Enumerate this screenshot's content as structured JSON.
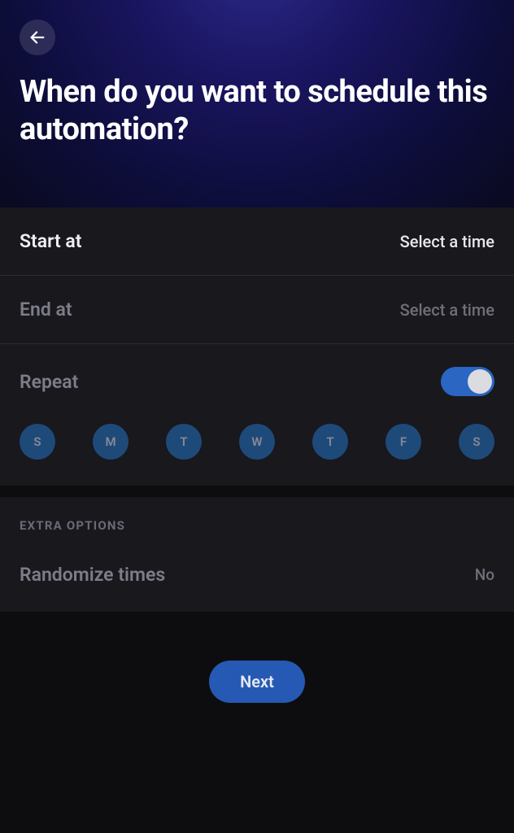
{
  "header": {
    "title": "When do you want to schedule this automation?"
  },
  "startAt": {
    "label": "Start at",
    "value": "Select a time"
  },
  "endAt": {
    "label": "End at",
    "value": "Select a time"
  },
  "repeat": {
    "label": "Repeat",
    "enabled": true,
    "days": [
      "S",
      "M",
      "T",
      "W",
      "T",
      "F",
      "S"
    ]
  },
  "extraOptions": {
    "header": "EXTRA OPTIONS",
    "randomize": {
      "label": "Randomize times",
      "value": "No"
    }
  },
  "footer": {
    "nextLabel": "Next"
  }
}
